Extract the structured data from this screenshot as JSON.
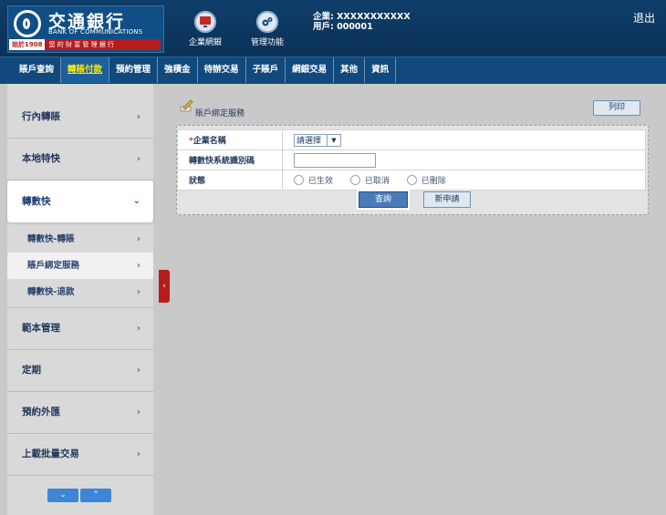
{
  "header": {
    "bank_name_cn": "交通銀行",
    "bank_name_en": "BANK OF COMMUNICATIONS",
    "since": "始於1908",
    "slogan": "您 的 財 富 管 理 銀 行",
    "nav": [
      {
        "label": "企業網銀",
        "icon": "computer-monitor-icon"
      },
      {
        "label": "管理功能",
        "icon": "gears-icon"
      }
    ],
    "company": "企業: XXXXXXXXXXX",
    "user": "用戶: 000001",
    "logout": "退出"
  },
  "main_nav": [
    {
      "label": "賬戶查詢",
      "active": false
    },
    {
      "label": "轉賬付款",
      "active": true
    },
    {
      "label": "預約管理",
      "active": false
    },
    {
      "label": "強積金",
      "active": false
    },
    {
      "label": "待辦交易",
      "active": false
    },
    {
      "label": "子賬戶",
      "active": false
    },
    {
      "label": "網銀交易",
      "active": false
    },
    {
      "label": "其他",
      "active": false
    },
    {
      "label": "資訊",
      "active": false
    }
  ],
  "sidebar": {
    "items": [
      {
        "label": "行內轉賬",
        "chevron": "›"
      },
      {
        "label": "本地特快",
        "chevron": "›"
      },
      {
        "label": "轉數快",
        "chevron": "⌄"
      },
      {
        "label": "範本管理",
        "chevron": "›"
      },
      {
        "label": "定期",
        "chevron": "›"
      },
      {
        "label": "預約外匯",
        "chevron": "›"
      },
      {
        "label": "上載批量交易",
        "chevron": "›"
      }
    ],
    "subitems": [
      {
        "label": "轉數快-轉賬",
        "chevron": "›"
      },
      {
        "label": "賬戶綁定服務",
        "chevron": "›"
      },
      {
        "label": "轉數快-退款",
        "chevron": "›"
      }
    ],
    "footer": {
      "down": "⌄",
      "up": "⌃"
    },
    "collapse_arrow": "‹"
  },
  "content": {
    "title": "賬戶綁定服務",
    "print_button": "列印",
    "form": {
      "company_label_req": "*",
      "company_label": "企業名稱",
      "company_select": "請選擇",
      "company_select_arrow": "▼",
      "fps_id_label": "轉數快系統識別碼",
      "fps_id_value": "",
      "status_label": "狀態",
      "status_options": [
        "已生效",
        "已取消",
        "已刪除"
      ]
    },
    "query_button": "查詢",
    "new_button": "新申請"
  },
  "colors": {
    "header_bg": "#0f3e6a",
    "nav_bg": "#11497d",
    "active_nav_text": "#ffea00",
    "brand_red": "#b71c1c",
    "page_bg": "#c9c9c9"
  }
}
